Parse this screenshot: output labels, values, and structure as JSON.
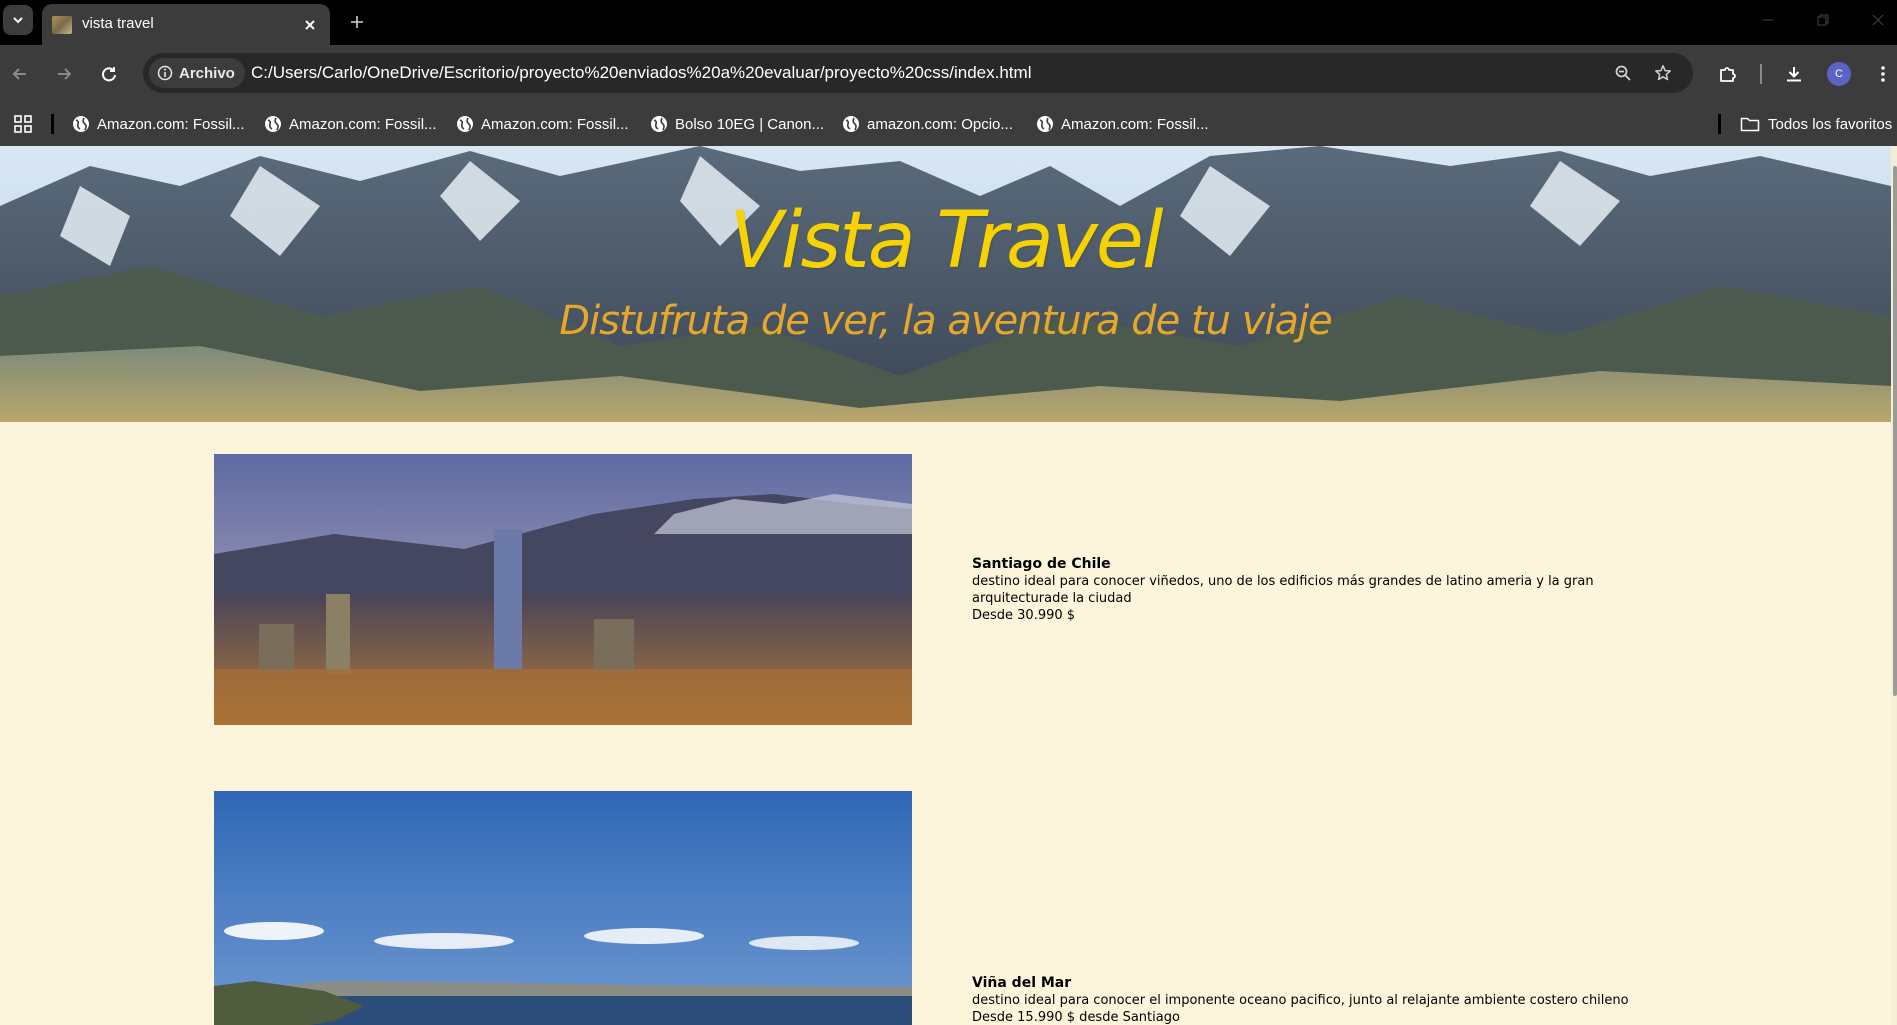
{
  "browser": {
    "tab": {
      "title": "vista travel"
    },
    "address_bar": {
      "site_chip": "Archivo",
      "url": "C:/Users/Carlo/OneDrive/Escritorio/proyecto%20enviados%20a%20evaluar/proyecto%20css/index.html"
    },
    "profile": {
      "initial": "C"
    },
    "bookmarks": [
      {
        "label": "Amazon.com: Fossil..."
      },
      {
        "label": "Amazon.com: Fossil..."
      },
      {
        "label": "Amazon.com: Fossil..."
      },
      {
        "label": "Bolso 10EG | Canon..."
      },
      {
        "label": "amazon.com: Opcio..."
      },
      {
        "label": "Amazon.com: Fossil..."
      }
    ],
    "all_bookmarks": "Todos los favoritos",
    "icons": {
      "tab_search": "chevron-down-icon",
      "close": "close-icon",
      "new_tab": "plus-icon",
      "back": "arrow-left-icon",
      "forward": "arrow-right-icon",
      "reload": "reload-icon",
      "zoom": "zoom-icon",
      "star": "star-icon",
      "extensions": "puzzle-icon",
      "download": "download-icon",
      "menu": "kebab-menu-icon"
    }
  },
  "page": {
    "hero": {
      "title": "Vista Travel",
      "subtitle": "Distufruta de ver, la aventura de tu viaje"
    },
    "destinations": [
      {
        "name": "Santiago de Chile",
        "description": "destino ideal para conocer viñedos, uno de los edificios más grandes de latino ameria y la gran arquitecturade la ciudad",
        "price": "Desde 30.990 $"
      },
      {
        "name": "Viña del Mar",
        "description": "destino ideal para conocer el imponente oceano pacifico, junto al relajante ambiente costero chileno",
        "price": "Desde 15.990 $ desde Santiago"
      }
    ]
  },
  "colors": {
    "page_background": "#fdf5db",
    "hero_title": "#f5d200",
    "hero_subtitle": "#e7a82a",
    "chrome_dark": "#3c3c3c"
  }
}
